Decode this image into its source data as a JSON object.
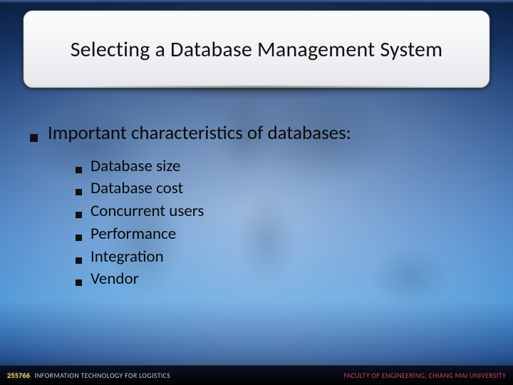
{
  "title": "Selecting a Database Management System",
  "main_point": "Important characteristics of databases:",
  "sub_points": [
    "Database size",
    "Database cost",
    "Concurrent users",
    "Performance",
    "Integration",
    "Vendor"
  ],
  "footer": {
    "course_code": "255766",
    "course_name": "INFORMATION TECHNOLOGY FOR LOGISTICS",
    "affiliation": "FACULTY OF ENGINEERING, CHIANG MAI UNIVERSITY"
  }
}
